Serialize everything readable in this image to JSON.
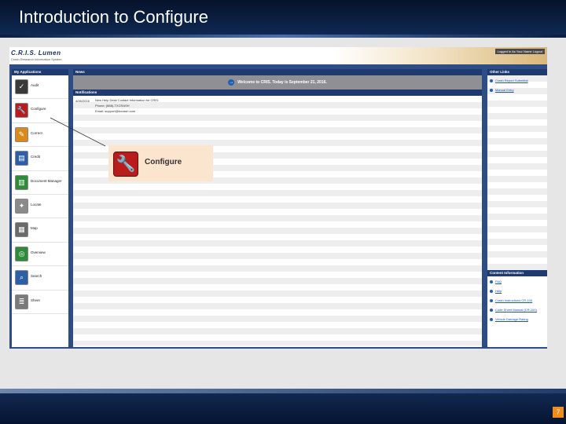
{
  "slide": {
    "title": "Introduction to Configure",
    "page_number": "7"
  },
  "app": {
    "logo": "C.R.I.S. Lumen",
    "logo_subtitle": "Crash Research Information System",
    "logged_in": "Logged in As Your Name Logout"
  },
  "applications": {
    "header": "My Applications",
    "items": [
      {
        "label": "Audit",
        "icon": "audit-icon",
        "color": "#3a3a3a"
      },
      {
        "label": "Configure",
        "icon": "wrench-icon",
        "color": "#b81c1c"
      },
      {
        "label": "Correct",
        "icon": "pencil-icon",
        "color": "#d98a1a"
      },
      {
        "label": "Credit",
        "icon": "credit-icon",
        "color": "#2d5fa8"
      },
      {
        "label": "Document Manager",
        "icon": "document-icon",
        "color": "#2e8b3a"
      },
      {
        "label": "Locate",
        "icon": "compass-icon",
        "color": "#8a8a8a"
      },
      {
        "label": "Map",
        "icon": "map-icon",
        "color": "#6a6a6a"
      },
      {
        "label": "Overview",
        "icon": "overview-icon",
        "color": "#2e8b3a"
      },
      {
        "label": "Search",
        "icon": "search-icon",
        "color": "#2d5fa8"
      },
      {
        "label": "Sheet",
        "icon": "sheet-icon",
        "color": "#7a7a7a"
      }
    ]
  },
  "news": {
    "header": "News",
    "welcome": "Welcome to CRIS. Today is September 21, 2016.",
    "notifications_header": "Notifications",
    "notification": {
      "date": "4/26/2016",
      "lines": [
        "New Help Desk Contact Information for CRIS:",
        "Phone: (888)-TXCRASH",
        "Email: support@txcrash.com"
      ]
    }
  },
  "other_links": {
    "header": "Other Links",
    "items": [
      "Crash Report Submittal",
      "Manual Entry"
    ]
  },
  "content_info": {
    "header": "Content Information",
    "items": [
      "FAQ",
      "Help",
      "Crash Instructions CR-100",
      "Code Sheet Manual (CR-100)",
      "Vehicle Damage Rating"
    ]
  },
  "callout": {
    "label": "Configure",
    "icon": "wrench-icon"
  }
}
